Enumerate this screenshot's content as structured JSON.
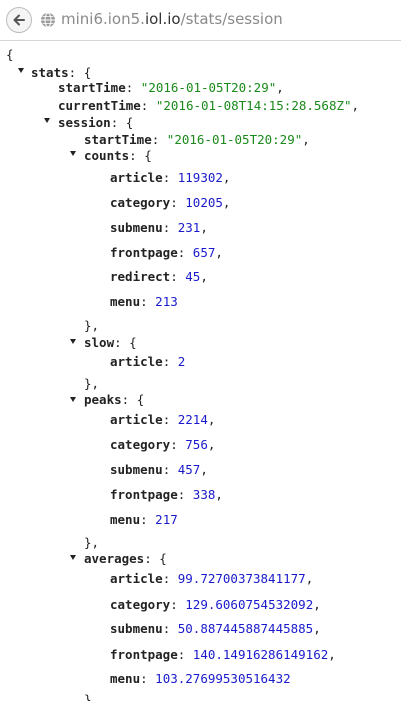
{
  "url": {
    "host_prefix": "mini6.ion5.",
    "host": "iol.io",
    "path": "/stats/session"
  },
  "json": {
    "open_brace": "{",
    "stats": {
      "key": "stats",
      "startTime": {
        "key": "startTime",
        "value": "\"2016-01-05T20:29\""
      },
      "currentTime": {
        "key": "currentTime",
        "value": "\"2016-01-08T14:15:28.568Z\""
      },
      "session": {
        "key": "session",
        "startTime": {
          "key": "startTime",
          "value": "\"2016-01-05T20:29\""
        },
        "counts": {
          "key": "counts",
          "items": [
            {
              "key": "article",
              "value": "119302"
            },
            {
              "key": "category",
              "value": "10205"
            },
            {
              "key": "submenu",
              "value": "231"
            },
            {
              "key": "frontpage",
              "value": "657"
            },
            {
              "key": "redirect",
              "value": "45"
            },
            {
              "key": "menu",
              "value": "213"
            }
          ]
        },
        "slow": {
          "key": "slow",
          "items": [
            {
              "key": "article",
              "value": "2"
            }
          ]
        },
        "peaks": {
          "key": "peaks",
          "items": [
            {
              "key": "article",
              "value": "2214"
            },
            {
              "key": "category",
              "value": "756"
            },
            {
              "key": "submenu",
              "value": "457"
            },
            {
              "key": "frontpage",
              "value": "338"
            },
            {
              "key": "menu",
              "value": "217"
            }
          ]
        },
        "averages": {
          "key": "averages",
          "items": [
            {
              "key": "article",
              "value": "99.72700373841177"
            },
            {
              "key": "category",
              "value": "129.6060754532092"
            },
            {
              "key": "submenu",
              "value": "50.887445887445885"
            },
            {
              "key": "frontpage",
              "value": "140.14916286149162"
            },
            {
              "key": "menu",
              "value": "103.27699530516432"
            }
          ]
        }
      }
    }
  }
}
